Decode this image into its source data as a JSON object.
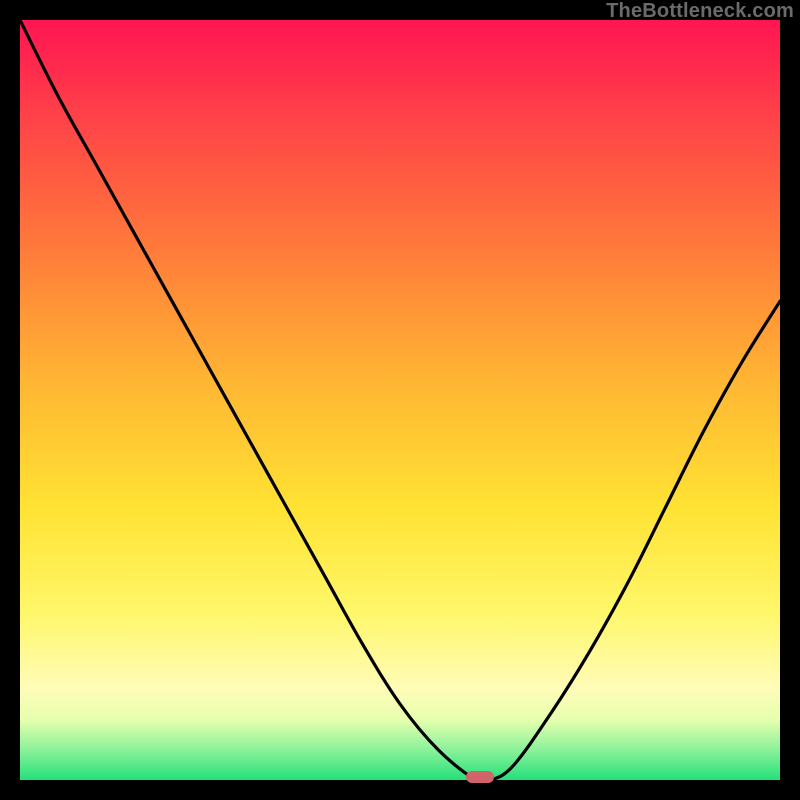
{
  "watermark": "TheBottleneck.com",
  "colors": {
    "frame": "#000000",
    "curve": "#000000",
    "marker": "#d1646a",
    "gradient_top": "#ff1552",
    "gradient_bottom": "#24e07a"
  },
  "chart_data": {
    "type": "line",
    "title": "",
    "xlabel": "",
    "ylabel": "",
    "x": [
      0.0,
      0.05,
      0.1,
      0.15,
      0.2,
      0.25,
      0.3,
      0.35,
      0.4,
      0.45,
      0.5,
      0.55,
      0.6,
      0.62,
      0.65,
      0.7,
      0.75,
      0.8,
      0.85,
      0.9,
      0.95,
      1.0
    ],
    "values": [
      100,
      90,
      81,
      72,
      63,
      54,
      45,
      36,
      27,
      18,
      10,
      4,
      0,
      0,
      2,
      9,
      17,
      26,
      36,
      46,
      55,
      63
    ],
    "xlim": [
      0,
      1
    ],
    "ylim": [
      0,
      100
    ],
    "notes": "V-shaped bottleneck curve. Minimum (≈0) occurs near x≈0.60–0.62 where the red marker sits. Left branch starts at 100 at x=0; right branch rises to ≈63 at x=1.",
    "marker": {
      "x": 0.605,
      "y": 0
    }
  }
}
